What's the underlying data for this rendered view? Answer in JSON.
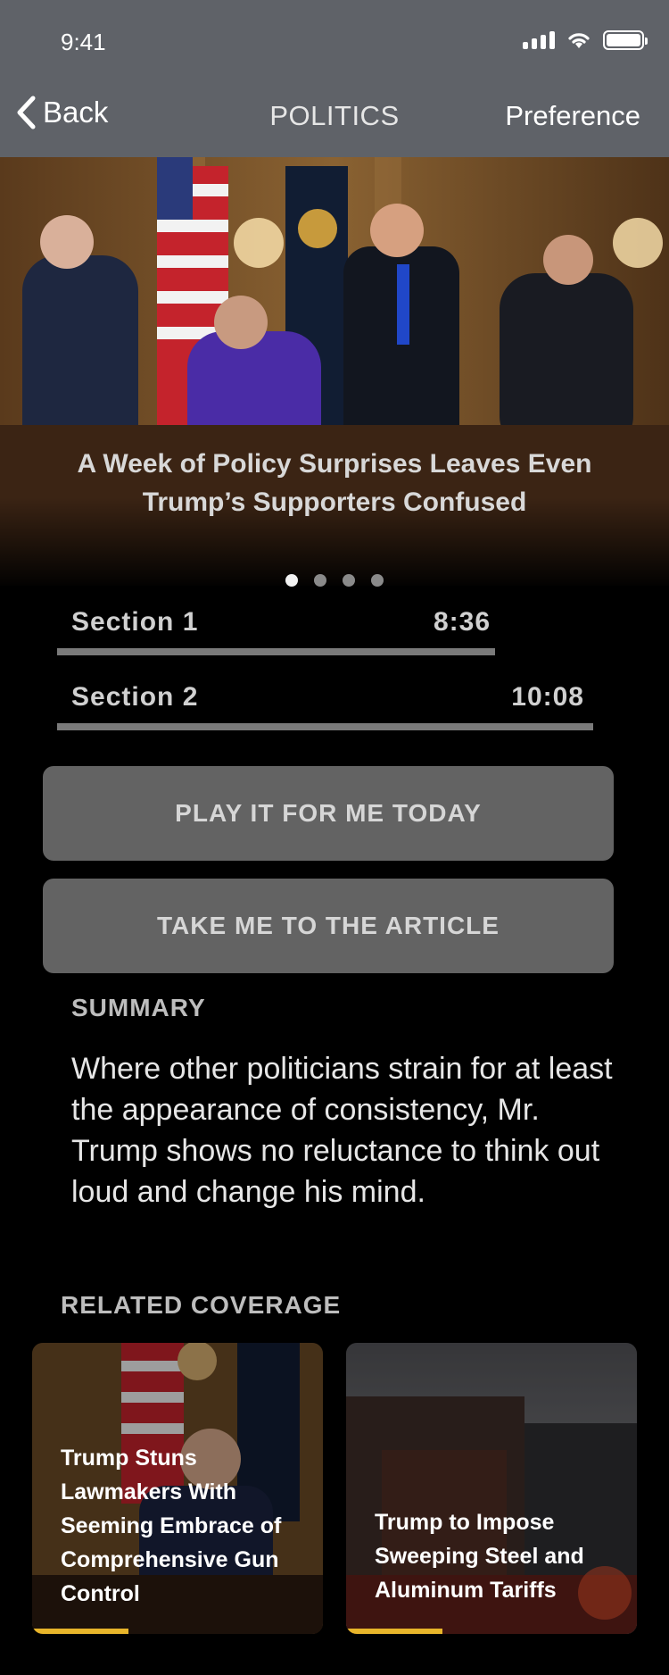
{
  "status": {
    "time": "9:41"
  },
  "nav": {
    "back_label": "Back",
    "title": "POLITICS",
    "preference_label": "Preference"
  },
  "hero": {
    "headline": "A Week of Policy Surprises Leaves Even Trump’s Supporters Confused",
    "pager": {
      "count": 4,
      "active_index": 0
    }
  },
  "sections": [
    {
      "label": "Section 1",
      "duration": "8:36"
    },
    {
      "label": "Section 2",
      "duration": "10:08"
    }
  ],
  "buttons": {
    "play": "PLAY IT FOR ME TODAY",
    "article": "TAKE ME TO THE ARTICLE"
  },
  "summary": {
    "label": "SUMMARY",
    "text": "Where other politicians strain for at least the appearance of consistency, Mr. Trump shows no reluctance to think out loud and change his mind."
  },
  "related": {
    "label": "RELATED COVERAGE",
    "items": [
      {
        "title": "Trump Stuns Lawmakers With Seeming Embrace of Comprehensive Gun Control",
        "progress": 0.33
      },
      {
        "title": "Trump to Impose Sweeping Steel and Aluminum Tariffs",
        "progress": 0.33
      }
    ]
  },
  "colors": {
    "nav_bar": "#5f6268",
    "button": "#636363",
    "progress_accent": "#e8b52a"
  }
}
